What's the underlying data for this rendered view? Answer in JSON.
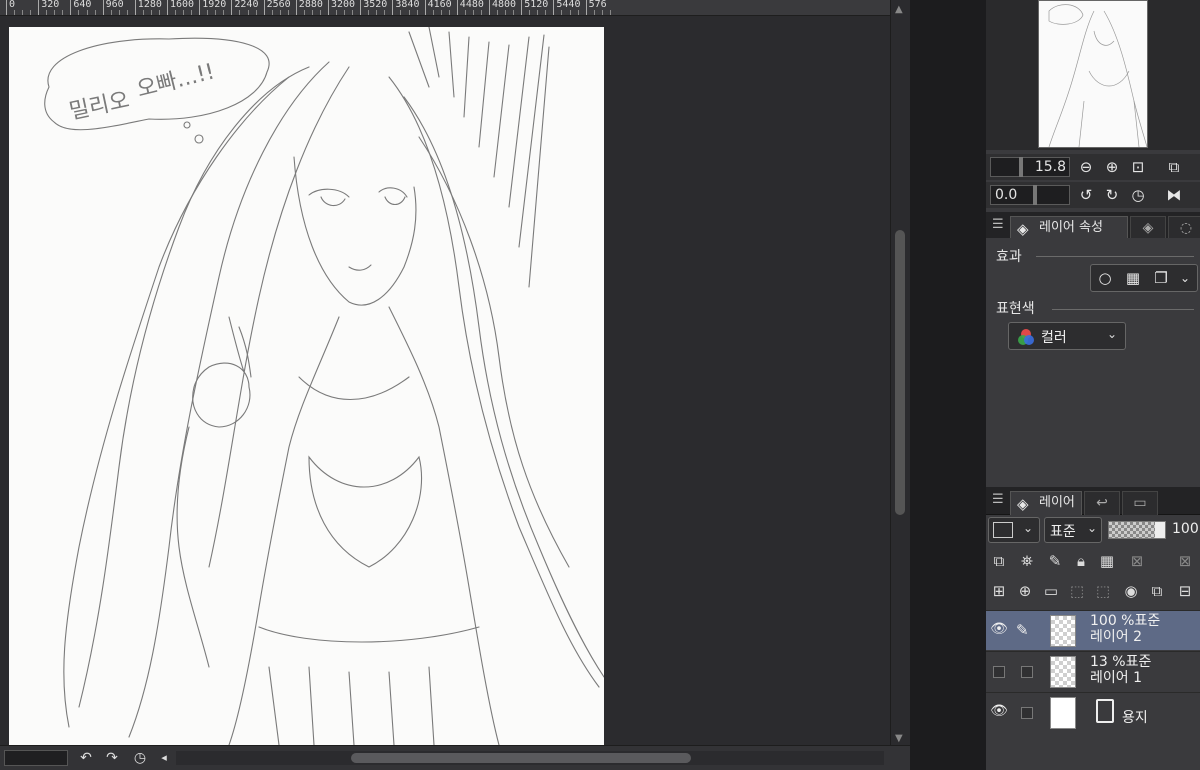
{
  "ruler": {
    "ticks": [
      "0",
      "320",
      "640",
      "960",
      "1280",
      "1600",
      "1920",
      "2240",
      "2560",
      "2880",
      "3200",
      "3520",
      "3840",
      "4160",
      "4480",
      "4800",
      "5120",
      "5440",
      "576"
    ]
  },
  "canvas": {
    "speech_bubble_text_1": "밀리오",
    "speech_bubble_text_2": "오빠...!!"
  },
  "navigator": {
    "zoom_value": "15.8",
    "rotate_value": "0.0",
    "icons": [
      "zoom-out-icon",
      "zoom-in-icon",
      "fit-icon",
      "actual-size-icon",
      "rotate-left-icon",
      "rotate-right-icon",
      "reset-rotation-icon",
      "flip-horizontal-icon"
    ]
  },
  "layer_property": {
    "tab_label": "레이어 속성",
    "effect_label": "효과",
    "color_label": "표현색",
    "color_value": "컬러"
  },
  "layer_panel": {
    "tab_label": "레이어",
    "blend_mode": "표준",
    "opacity": "100",
    "layers": [
      {
        "opacity_mode": "100 %표준",
        "name": "레이어 2",
        "visible": true,
        "selected": true
      },
      {
        "opacity_mode": "13 %표준",
        "name": "레이어 1",
        "visible": false,
        "selected": false
      },
      {
        "opacity_mode": "",
        "name": "용지",
        "visible": true,
        "selected": false
      }
    ]
  },
  "colors": {
    "background": "#2b2b2e",
    "panel": "#3a3a3d",
    "selected_layer": "#5e6a86",
    "paper": "#fbfbfa"
  }
}
